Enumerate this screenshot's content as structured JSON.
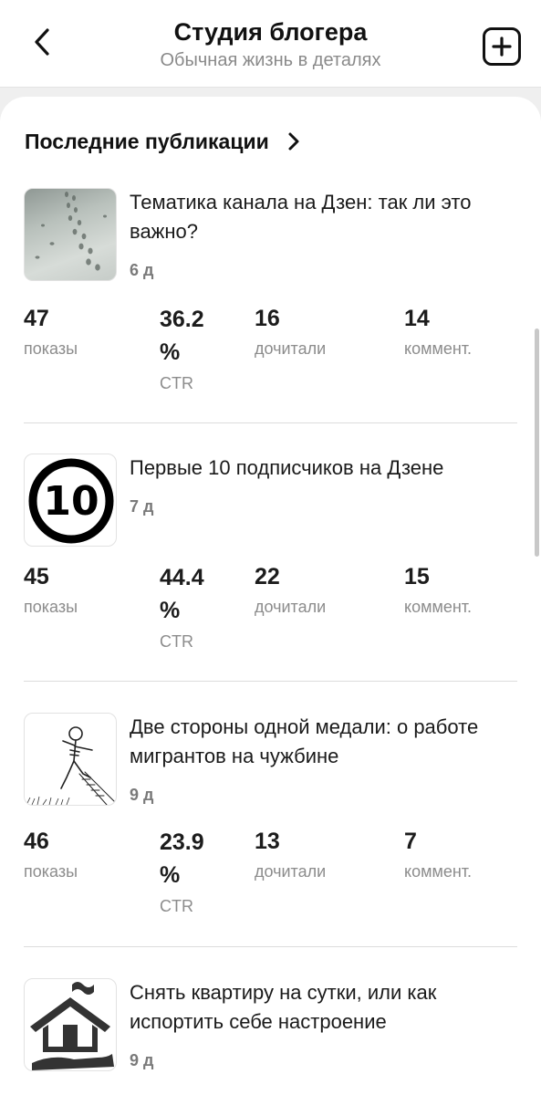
{
  "header": {
    "title": "Студия блогера",
    "subtitle": "Обычная жизнь в деталях",
    "back_icon": "chevron-left-icon",
    "add_icon": "plus-square-icon"
  },
  "section": {
    "title": "Последние публикации",
    "icon": "chevron-right-icon"
  },
  "posts": [
    {
      "title": "Тематика канала на Дзен: так ли это важно?",
      "age": "6 д",
      "thumbnail": "snow-footprints-image",
      "stats": [
        {
          "value": "47",
          "label": "показы"
        },
        {
          "value": "36.2 %",
          "label": "CTR"
        },
        {
          "value": "16",
          "label": "дочитали"
        },
        {
          "value": "14",
          "label": "коммент."
        }
      ]
    },
    {
      "title": "Первые 10 подписчиков на Дзене",
      "age": "7 д",
      "thumbnail": "number-10-circle-icon",
      "stats": [
        {
          "value": "45",
          "label": "показы"
        },
        {
          "value": "44.4 %",
          "label": "CTR"
        },
        {
          "value": "22",
          "label": "дочитали"
        },
        {
          "value": "15",
          "label": "коммент."
        }
      ]
    },
    {
      "title": "Две стороны одной медали: о работе мигрантов на чужбине",
      "age": "9 д",
      "thumbnail": "skeleton-sketch-image",
      "stats": [
        {
          "value": "46",
          "label": "показы"
        },
        {
          "value": "23.9 %",
          "label": "CTR"
        },
        {
          "value": "13",
          "label": "дочитали"
        },
        {
          "value": "7",
          "label": "коммент."
        }
      ]
    },
    {
      "title": "Снять квартиру на сутки, или как испортить себе настроение",
      "age": "9 д",
      "thumbnail": "house-hand-icon"
    }
  ]
}
